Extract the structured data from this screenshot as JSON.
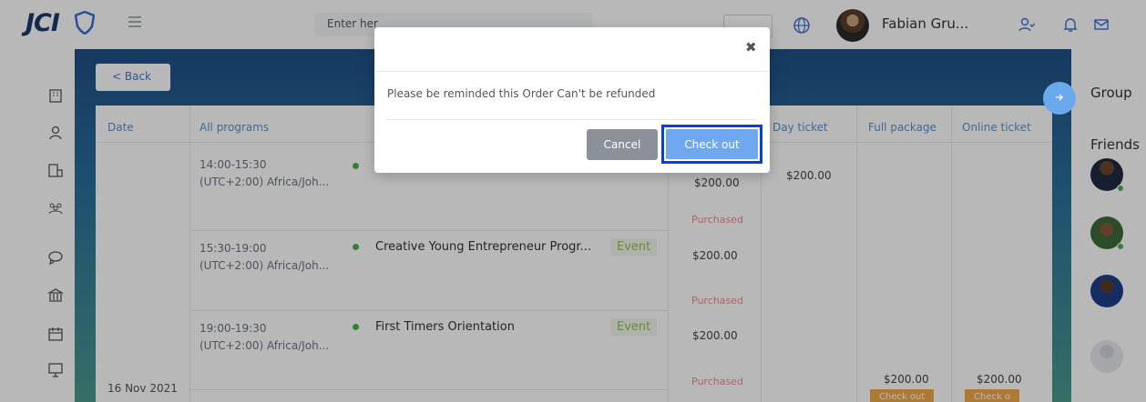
{
  "header": {
    "logo_text": "JCI",
    "search_placeholder": "Enter her",
    "user_name": "Fabian Gru..."
  },
  "main": {
    "back_label": "< Back",
    "table_headers": [
      "Date",
      "All programs",
      "Day ticket",
      "Full package",
      "Online ticket"
    ],
    "rows": [
      {
        "time": "14:00-15:30",
        "tz": "(UTC+2:00) Africa/Joh...",
        "program": "",
        "tag": "",
        "price": "$200.00",
        "price2": "$200.00",
        "status": "Purchased"
      },
      {
        "time": "15:30-19:00",
        "tz": "(UTC+2:00) Africa/Joh...",
        "program": "Creative Young Entrepreneur Progr...",
        "tag": "Event",
        "price": "$200.00",
        "status": "Purchased"
      },
      {
        "time": "19:00-19:30",
        "tz": "(UTC+2:00) Africa/Joh...",
        "program": "First Timers Orientation",
        "tag": "Event",
        "price": "$200.00",
        "status": "Purchased"
      }
    ],
    "date": "16 Nov 2021",
    "full_package_price": "$200.00",
    "online_ticket_price": "$200.00",
    "full_package_btn": "Check out",
    "online_ticket_btn": "Check o"
  },
  "right_panel": {
    "group_label": "Group",
    "friends_label": "Friends"
  },
  "modal": {
    "close_glyph": "✖",
    "message": "Please be reminded this Order Can't be refunded",
    "cancel_label": "Cancel",
    "checkout_label": "Check out"
  },
  "colors": {
    "brand_navy": "#1b3a6b",
    "accent_blue": "#6fa8f0",
    "highlight": "#0a3fd6",
    "event_green": "#8bc34a",
    "purchased_red": "#f08a8a"
  }
}
